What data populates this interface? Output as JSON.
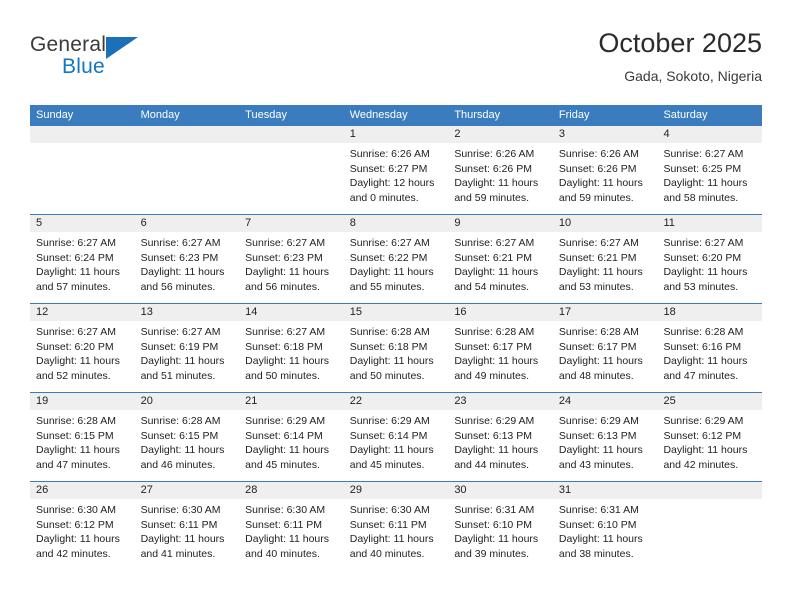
{
  "logo": {
    "line1": "General",
    "line2": "Blue",
    "triangle_color": "#1b70b8"
  },
  "header": {
    "title": "October 2025",
    "location": "Gada, Sokoto, Nigeria"
  },
  "colors": {
    "header_blue": "#3a7cbe",
    "day_band_grey": "#efefef",
    "text": "#222222"
  },
  "weekdays": [
    "Sunday",
    "Monday",
    "Tuesday",
    "Wednesday",
    "Thursday",
    "Friday",
    "Saturday"
  ],
  "weeks": [
    [
      {
        "day": "",
        "sunrise": "",
        "sunset": "",
        "daylight_line1": "",
        "daylight_line2": "",
        "empty": true
      },
      {
        "day": "",
        "sunrise": "",
        "sunset": "",
        "daylight_line1": "",
        "daylight_line2": "",
        "empty": true
      },
      {
        "day": "",
        "sunrise": "",
        "sunset": "",
        "daylight_line1": "",
        "daylight_line2": "",
        "empty": true
      },
      {
        "day": "1",
        "sunrise": "Sunrise: 6:26 AM",
        "sunset": "Sunset: 6:27 PM",
        "daylight_line1": "Daylight: 12 hours",
        "daylight_line2": "and 0 minutes.",
        "empty": false
      },
      {
        "day": "2",
        "sunrise": "Sunrise: 6:26 AM",
        "sunset": "Sunset: 6:26 PM",
        "daylight_line1": "Daylight: 11 hours",
        "daylight_line2": "and 59 minutes.",
        "empty": false
      },
      {
        "day": "3",
        "sunrise": "Sunrise: 6:26 AM",
        "sunset": "Sunset: 6:26 PM",
        "daylight_line1": "Daylight: 11 hours",
        "daylight_line2": "and 59 minutes.",
        "empty": false
      },
      {
        "day": "4",
        "sunrise": "Sunrise: 6:27 AM",
        "sunset": "Sunset: 6:25 PM",
        "daylight_line1": "Daylight: 11 hours",
        "daylight_line2": "and 58 minutes.",
        "empty": false
      }
    ],
    [
      {
        "day": "5",
        "sunrise": "Sunrise: 6:27 AM",
        "sunset": "Sunset: 6:24 PM",
        "daylight_line1": "Daylight: 11 hours",
        "daylight_line2": "and 57 minutes.",
        "empty": false
      },
      {
        "day": "6",
        "sunrise": "Sunrise: 6:27 AM",
        "sunset": "Sunset: 6:23 PM",
        "daylight_line1": "Daylight: 11 hours",
        "daylight_line2": "and 56 minutes.",
        "empty": false
      },
      {
        "day": "7",
        "sunrise": "Sunrise: 6:27 AM",
        "sunset": "Sunset: 6:23 PM",
        "daylight_line1": "Daylight: 11 hours",
        "daylight_line2": "and 56 minutes.",
        "empty": false
      },
      {
        "day": "8",
        "sunrise": "Sunrise: 6:27 AM",
        "sunset": "Sunset: 6:22 PM",
        "daylight_line1": "Daylight: 11 hours",
        "daylight_line2": "and 55 minutes.",
        "empty": false
      },
      {
        "day": "9",
        "sunrise": "Sunrise: 6:27 AM",
        "sunset": "Sunset: 6:21 PM",
        "daylight_line1": "Daylight: 11 hours",
        "daylight_line2": "and 54 minutes.",
        "empty": false
      },
      {
        "day": "10",
        "sunrise": "Sunrise: 6:27 AM",
        "sunset": "Sunset: 6:21 PM",
        "daylight_line1": "Daylight: 11 hours",
        "daylight_line2": "and 53 minutes.",
        "empty": false
      },
      {
        "day": "11",
        "sunrise": "Sunrise: 6:27 AM",
        "sunset": "Sunset: 6:20 PM",
        "daylight_line1": "Daylight: 11 hours",
        "daylight_line2": "and 53 minutes.",
        "empty": false
      }
    ],
    [
      {
        "day": "12",
        "sunrise": "Sunrise: 6:27 AM",
        "sunset": "Sunset: 6:20 PM",
        "daylight_line1": "Daylight: 11 hours",
        "daylight_line2": "and 52 minutes.",
        "empty": false
      },
      {
        "day": "13",
        "sunrise": "Sunrise: 6:27 AM",
        "sunset": "Sunset: 6:19 PM",
        "daylight_line1": "Daylight: 11 hours",
        "daylight_line2": "and 51 minutes.",
        "empty": false
      },
      {
        "day": "14",
        "sunrise": "Sunrise: 6:27 AM",
        "sunset": "Sunset: 6:18 PM",
        "daylight_line1": "Daylight: 11 hours",
        "daylight_line2": "and 50 minutes.",
        "empty": false
      },
      {
        "day": "15",
        "sunrise": "Sunrise: 6:28 AM",
        "sunset": "Sunset: 6:18 PM",
        "daylight_line1": "Daylight: 11 hours",
        "daylight_line2": "and 50 minutes.",
        "empty": false
      },
      {
        "day": "16",
        "sunrise": "Sunrise: 6:28 AM",
        "sunset": "Sunset: 6:17 PM",
        "daylight_line1": "Daylight: 11 hours",
        "daylight_line2": "and 49 minutes.",
        "empty": false
      },
      {
        "day": "17",
        "sunrise": "Sunrise: 6:28 AM",
        "sunset": "Sunset: 6:17 PM",
        "daylight_line1": "Daylight: 11 hours",
        "daylight_line2": "and 48 minutes.",
        "empty": false
      },
      {
        "day": "18",
        "sunrise": "Sunrise: 6:28 AM",
        "sunset": "Sunset: 6:16 PM",
        "daylight_line1": "Daylight: 11 hours",
        "daylight_line2": "and 47 minutes.",
        "empty": false
      }
    ],
    [
      {
        "day": "19",
        "sunrise": "Sunrise: 6:28 AM",
        "sunset": "Sunset: 6:15 PM",
        "daylight_line1": "Daylight: 11 hours",
        "daylight_line2": "and 47 minutes.",
        "empty": false
      },
      {
        "day": "20",
        "sunrise": "Sunrise: 6:28 AM",
        "sunset": "Sunset: 6:15 PM",
        "daylight_line1": "Daylight: 11 hours",
        "daylight_line2": "and 46 minutes.",
        "empty": false
      },
      {
        "day": "21",
        "sunrise": "Sunrise: 6:29 AM",
        "sunset": "Sunset: 6:14 PM",
        "daylight_line1": "Daylight: 11 hours",
        "daylight_line2": "and 45 minutes.",
        "empty": false
      },
      {
        "day": "22",
        "sunrise": "Sunrise: 6:29 AM",
        "sunset": "Sunset: 6:14 PM",
        "daylight_line1": "Daylight: 11 hours",
        "daylight_line2": "and 45 minutes.",
        "empty": false
      },
      {
        "day": "23",
        "sunrise": "Sunrise: 6:29 AM",
        "sunset": "Sunset: 6:13 PM",
        "daylight_line1": "Daylight: 11 hours",
        "daylight_line2": "and 44 minutes.",
        "empty": false
      },
      {
        "day": "24",
        "sunrise": "Sunrise: 6:29 AM",
        "sunset": "Sunset: 6:13 PM",
        "daylight_line1": "Daylight: 11 hours",
        "daylight_line2": "and 43 minutes.",
        "empty": false
      },
      {
        "day": "25",
        "sunrise": "Sunrise: 6:29 AM",
        "sunset": "Sunset: 6:12 PM",
        "daylight_line1": "Daylight: 11 hours",
        "daylight_line2": "and 42 minutes.",
        "empty": false
      }
    ],
    [
      {
        "day": "26",
        "sunrise": "Sunrise: 6:30 AM",
        "sunset": "Sunset: 6:12 PM",
        "daylight_line1": "Daylight: 11 hours",
        "daylight_line2": "and 42 minutes.",
        "empty": false
      },
      {
        "day": "27",
        "sunrise": "Sunrise: 6:30 AM",
        "sunset": "Sunset: 6:11 PM",
        "daylight_line1": "Daylight: 11 hours",
        "daylight_line2": "and 41 minutes.",
        "empty": false
      },
      {
        "day": "28",
        "sunrise": "Sunrise: 6:30 AM",
        "sunset": "Sunset: 6:11 PM",
        "daylight_line1": "Daylight: 11 hours",
        "daylight_line2": "and 40 minutes.",
        "empty": false
      },
      {
        "day": "29",
        "sunrise": "Sunrise: 6:30 AM",
        "sunset": "Sunset: 6:11 PM",
        "daylight_line1": "Daylight: 11 hours",
        "daylight_line2": "and 40 minutes.",
        "empty": false
      },
      {
        "day": "30",
        "sunrise": "Sunrise: 6:31 AM",
        "sunset": "Sunset: 6:10 PM",
        "daylight_line1": "Daylight: 11 hours",
        "daylight_line2": "and 39 minutes.",
        "empty": false
      },
      {
        "day": "31",
        "sunrise": "Sunrise: 6:31 AM",
        "sunset": "Sunset: 6:10 PM",
        "daylight_line1": "Daylight: 11 hours",
        "daylight_line2": "and 38 minutes.",
        "empty": false
      },
      {
        "day": "",
        "sunrise": "",
        "sunset": "",
        "daylight_line1": "",
        "daylight_line2": "",
        "empty": true
      }
    ]
  ]
}
